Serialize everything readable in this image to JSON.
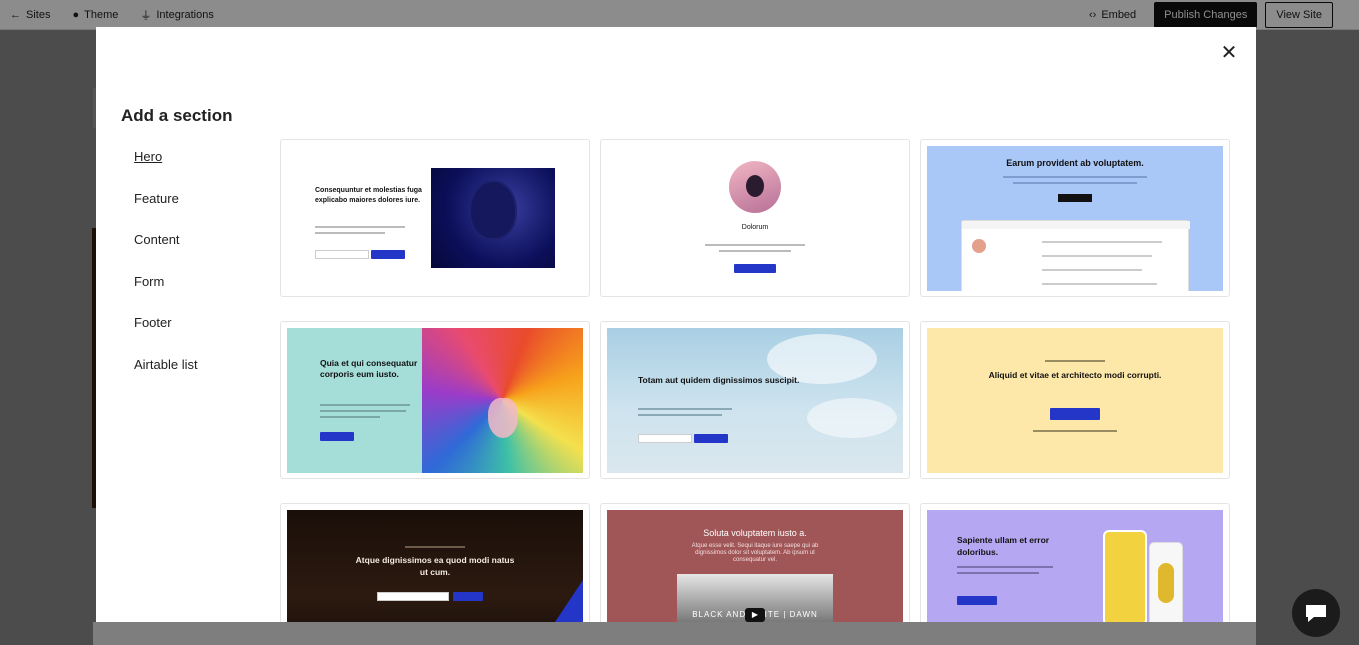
{
  "topbar": {
    "sites": "Sites",
    "theme": "Theme",
    "integrations": "Integrations",
    "embed": "Embed",
    "publish": "Publish Changes",
    "view_site": "View Site"
  },
  "modal": {
    "title": "Add a section",
    "close_icon": "close-icon",
    "categories": [
      "Hero",
      "Feature",
      "Content",
      "Form",
      "Footer",
      "Airtable list"
    ],
    "active_category": "Hero"
  },
  "cards": [
    {
      "heading": "Consequuntur et molestias fuga explicabo maiores dolores iure.",
      "button": "SUBSCRIBE NOW"
    },
    {
      "heading": "Dolorum",
      "button": "Follow"
    },
    {
      "heading": "Earum provident ab voluptatem.",
      "button": "Learn More"
    },
    {
      "heading": "Quia et qui consequatur corporis eum iusto.",
      "button": "Read Article"
    },
    {
      "heading": "Totam aut quidem dignissimos suscipit.",
      "button": "Subscribe"
    },
    {
      "heading": "Aliquid et vitae et architecto modi corrupti.",
      "button": "Browse Collection"
    },
    {
      "heading": "Atque dignissimos ea quod modi natus ut cum.",
      "button": "Sign Up Now"
    },
    {
      "heading": "Soluta voluptatem iusto a.",
      "subheading": "Atque esse velit. Sequi itaque iure saepe qui ab dignissimos dolor sit voluptatem. Ab ipsum ut consequatur vel.",
      "video_text": "BLACK AND WHITE | DAWN"
    },
    {
      "heading": "Sapiente ullam et error doloribus.",
      "button": "Shop Now"
    }
  ],
  "colors": {
    "accent": "#2436c8",
    "card3_bg": "#a9c8f7",
    "card4_bg": "#a5ddd8",
    "card6_bg": "#fde8a9",
    "card8_bg": "#a05657",
    "card9_bg": "#b5a7f2"
  }
}
